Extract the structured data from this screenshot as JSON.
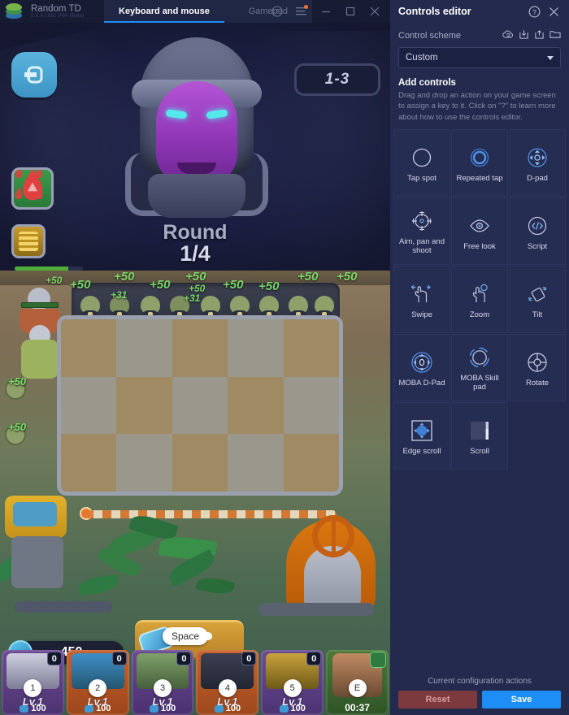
{
  "titlebar": {
    "app_name": "Random TD",
    "version": "5.8.0.1081 P64 (Beta)",
    "logo_icon": "bluestacks-logo-icon",
    "tabs": [
      {
        "label": "Keyboard and mouse",
        "active": true
      },
      {
        "label": "Gamepad",
        "active": false
      }
    ],
    "help_icon": "question-circle-icon",
    "menu_icon": "hamburger-menu-icon",
    "minimize_icon": "minimize-icon",
    "maximize_icon": "maximize-icon",
    "close_icon": "close-icon"
  },
  "game": {
    "back_icon": "back-arrow-icon",
    "blood_icon": "blood-drop-icon",
    "gold_icon": "gold-bars-icon",
    "level_chip": "1-3",
    "round_label": "Round",
    "round_value": "1/4",
    "gold_amount": "450",
    "space_key": "Space",
    "timer": "00:37",
    "floats": [
      "+50",
      "+50",
      "+50",
      "+50",
      "+50",
      "+50",
      "+50",
      "+31",
      "+31",
      "+50",
      "+50",
      "+50"
    ],
    "side_coins": [
      "+50",
      "+50"
    ],
    "cards": [
      {
        "key": "1",
        "level": "Lv.1",
        "cost": "100",
        "count": "0"
      },
      {
        "key": "2",
        "level": "Lv.1",
        "cost": "100",
        "count": "0"
      },
      {
        "key": "3",
        "level": "Lv.1",
        "cost": "100",
        "count": "0"
      },
      {
        "key": "4",
        "level": "Lv.1",
        "cost": "100",
        "count": "0"
      },
      {
        "key": "5",
        "level": "Lv.1",
        "cost": "100",
        "count": "0"
      }
    ],
    "hero_key": "E"
  },
  "panel": {
    "title": "Controls editor",
    "help_icon": "question-circle-icon",
    "close_icon": "close-icon",
    "scheme_label": "Control scheme",
    "scheme_icons": [
      "cloud-restore-icon",
      "import-scheme-icon",
      "export-scheme-icon",
      "open-folder-icon"
    ],
    "scheme_value": "Custom",
    "add_title": "Add controls",
    "add_desc": "Drag and drop an action on your game screen to assign a key to it. Click on \"?\" to learn more about how to use the controls editor.",
    "controls": [
      {
        "label": "Tap spot",
        "icon": "tap-spot-icon"
      },
      {
        "label": "Repeated tap",
        "icon": "repeated-tap-icon"
      },
      {
        "label": "D-pad",
        "icon": "d-pad-icon"
      },
      {
        "label": "Aim, pan and shoot",
        "icon": "aim-pan-shoot-icon"
      },
      {
        "label": "Free look",
        "icon": "free-look-icon"
      },
      {
        "label": "Script",
        "icon": "script-icon"
      },
      {
        "label": "Swipe",
        "icon": "swipe-icon"
      },
      {
        "label": "Zoom",
        "icon": "zoom-icon"
      },
      {
        "label": "Tilt",
        "icon": "tilt-icon"
      },
      {
        "label": "MOBA D-Pad",
        "icon": "moba-dpad-icon"
      },
      {
        "label": "MOBA Skill pad",
        "icon": "moba-skill-pad-icon"
      },
      {
        "label": "Rotate",
        "icon": "rotate-icon"
      },
      {
        "label": "Edge scroll",
        "icon": "edge-scroll-icon"
      },
      {
        "label": "Scroll",
        "icon": "scroll-icon"
      }
    ],
    "footer_label": "Current configuration actions",
    "reset_label": "Reset",
    "save_label": "Save",
    "accent_color": "#1c8ef5",
    "reset_color": "#7c3a3f"
  }
}
